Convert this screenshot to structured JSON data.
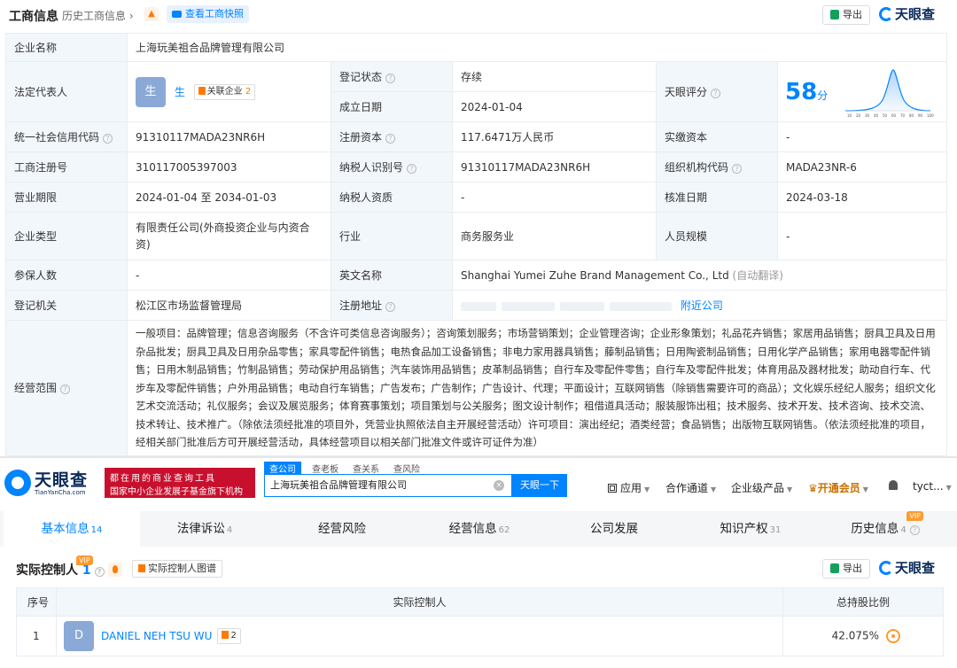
{
  "panel1": {
    "title": "工商信息",
    "history_link": "历史工商信息 ›",
    "snapshot_btn": "查看工商快照",
    "export_btn": "导出",
    "brand": "天眼查",
    "company_name_label": "企业名称",
    "company_name": "上海玩美祖合品牌管理有限公司",
    "legal_rep_label": "法定代表人",
    "legal_rep_avatar": "生",
    "legal_rep_name": "生",
    "legal_rep_related": "关联企业",
    "legal_rep_related_count": "2",
    "reg_status_label": "登记状态",
    "reg_status": "存续",
    "founded_label": "成立日期",
    "founded": "2024-01-04",
    "score_label": "天眼评分",
    "score": "58",
    "score_unit": "分",
    "score_axis": [
      "10",
      "20",
      "30",
      "40",
      "50",
      "60",
      "70",
      "80",
      "90",
      "100"
    ],
    "credit_code_label": "统一社会信用代码",
    "credit_code": "91310117MADA23NR6H",
    "reg_capital_label": "注册资本",
    "reg_capital": "117.6471万人民币",
    "paid_capital_label": "实缴资本",
    "paid_capital": "-",
    "reg_no_label": "工商注册号",
    "reg_no": "310117005397003",
    "tax_id_label": "纳税人识别号",
    "tax_id": "91310117MADA23NR6H",
    "org_code_label": "组织机构代码",
    "org_code": "MADA23NR-6",
    "term_label": "营业期限",
    "term": "2024-01-04 至 2034-01-03",
    "tax_qual_label": "纳税人资质",
    "tax_qual": "-",
    "approval_label": "核准日期",
    "approval": "2024-03-18",
    "type_label": "企业类型",
    "type": "有限责任公司(外商投资企业与内资合资)",
    "industry_label": "行业",
    "industry": "商务服务业",
    "staff_label": "人员规模",
    "staff": "-",
    "insured_label": "参保人数",
    "insured": "-",
    "en_name_label": "英文名称",
    "en_name": "Shanghai Yumei Zuhe Brand Management Co., Ltd",
    "en_name_note": "(自动翻译)",
    "authority_label": "登记机关",
    "authority": "松江区市场监督管理局",
    "address_label": "注册地址",
    "address_link": "附近公司",
    "scope_label": "经营范围",
    "scope": "一般项目：品牌管理；信息咨询服务（不含许可类信息咨询服务）；咨询策划服务；市场营销策划；企业管理咨询；企业形象策划；礼品花卉销售；家居用品销售；厨具卫具及日用杂品批发；厨具卫具及日用杂品零售；家具零配件销售；电热食品加工设备销售；非电力家用器具销售；藤制品销售；日用陶瓷制品销售；日用化学产品销售；家用电器零配件销售；日用木制品销售；竹制品销售；劳动保护用品销售；汽车装饰用品销售；皮革制品销售；自行车及零配件零售；自行车及零配件批发；体育用品及器材批发；助动自行车、代步车及零配件销售；户外用品销售；电动自行车销售；广告发布；广告制作；广告设计、代理；平面设计；互联网销售（除销售需要许可的商品）；文化娱乐经纪人服务；组织文化艺术交流活动；礼仪服务；会议及展览服务；体育赛事策划；项目策划与公关服务；图文设计制作；租借道具活动；服装服饰出租；技术服务、技术开发、技术咨询、技术交流、技术转让、技术推广。（除依法须经批准的项目外，凭营业执照依法自主开展经营活动）许可项目：演出经纪；酒类经营；食品销售；出版物互联网销售。（依法须经批准的项目，经相关部门批准后方可开展经营活动，具体经营项目以相关部门批准文件或许可证件为准）"
  },
  "nav": {
    "logo_cn": "天眼查",
    "logo_en": "TianYanCha.com",
    "banner_line1": "都在用的商业查询工具",
    "banner_line2": "国家中小企业发展子基金旗下机构",
    "search_tabs": [
      "查公司",
      "查老板",
      "查关系",
      "查风险"
    ],
    "search_value": "上海玩美祖合品牌管理有限公司",
    "search_btn": "天眼一下",
    "apps": "应用",
    "channel": "合作通道",
    "enterprise": "企业级产品",
    "vip": "开通会员",
    "user": "tyct..."
  },
  "tabs": [
    {
      "label": "基本信息",
      "count": "14"
    },
    {
      "label": "法律诉讼",
      "count": "4"
    },
    {
      "label": "经营风险",
      "count": ""
    },
    {
      "label": "经营信息",
      "count": "62"
    },
    {
      "label": "公司发展",
      "count": ""
    },
    {
      "label": "知识产权",
      "count": "31"
    },
    {
      "label": "历史信息",
      "count": "4"
    }
  ],
  "vip_badge": "VIP",
  "controller": {
    "title": "实际控制人",
    "count": "1",
    "chart_btn": "实际控制人图谱",
    "export_btn": "导出",
    "brand": "天眼查",
    "headers": [
      "序号",
      "实际控制人",
      "总持股比例"
    ],
    "rows": [
      {
        "index": "1",
        "avatar": "D",
        "name": "DANIEL NEH TSU WU",
        "tag_count": "2",
        "ratio": "42.075%"
      }
    ]
  },
  "colors": {
    "accent": "#0084ff",
    "label_bg": "#f2f7fc",
    "status_green": "#13a556",
    "banner_red": "#c8102e"
  }
}
